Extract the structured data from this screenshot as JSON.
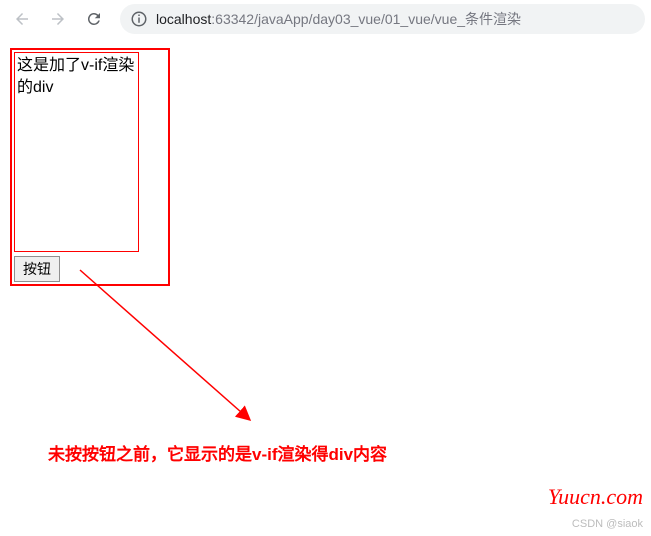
{
  "toolbar": {
    "url_host": "localhost",
    "url_port": ":63342",
    "url_path": "/javaApp/day03_vue/01_vue/vue_条件渲染"
  },
  "content": {
    "vif_box_text": "这是加了v-if渲染的div",
    "button_label": "按钮"
  },
  "annotation": {
    "text": "未按按钮之前，它显示的是v-if渲染得div内容"
  },
  "watermark": {
    "text": "Yuucn.com",
    "csdn": "CSDN @siaok"
  }
}
